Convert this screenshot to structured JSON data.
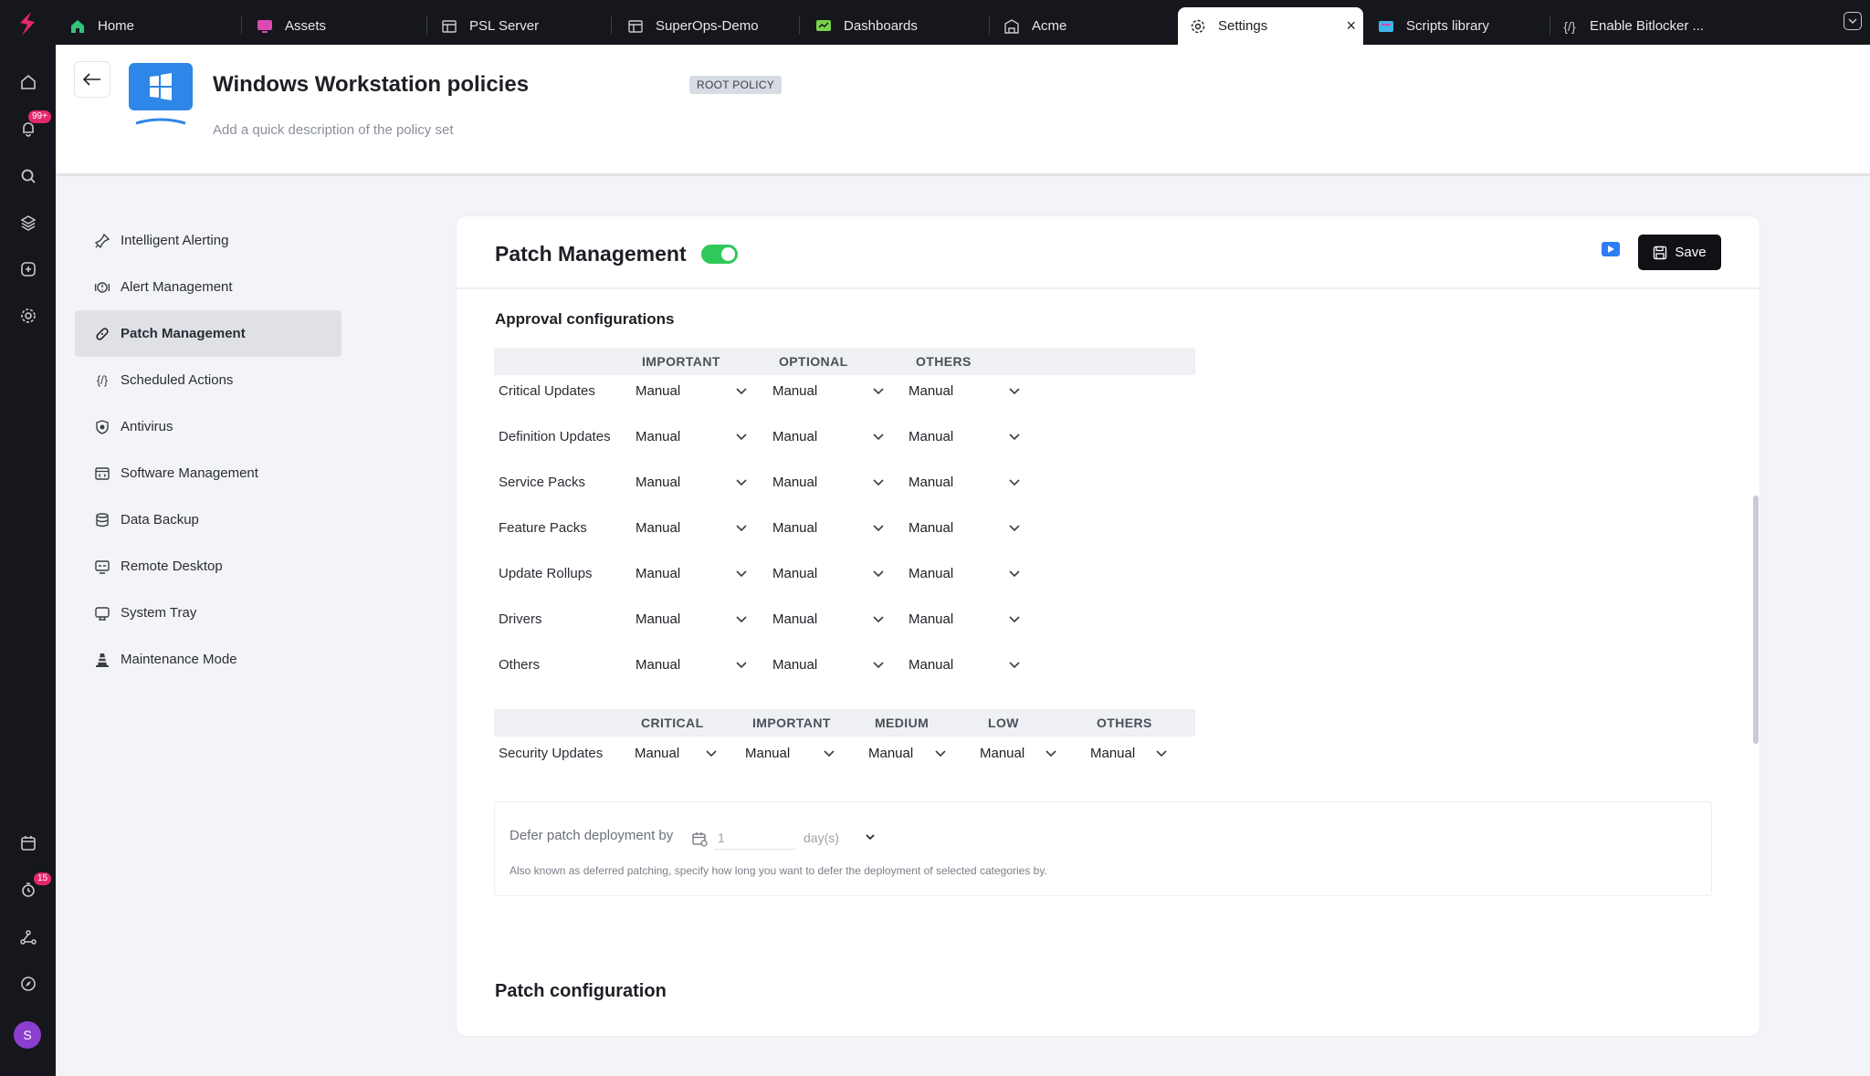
{
  "tabs": [
    {
      "label": "Home",
      "icon": "home-icon"
    },
    {
      "label": "Assets",
      "icon": "monitor-icon"
    },
    {
      "label": "PSL Server",
      "icon": "table-icon"
    },
    {
      "label": "SuperOps-Demo",
      "icon": "table-icon"
    },
    {
      "label": "Dashboards",
      "icon": "dashboard-icon"
    },
    {
      "label": "Acme",
      "icon": "building-icon"
    },
    {
      "label": "Settings",
      "icon": "gear-icon",
      "active": true
    },
    {
      "label": "Scripts library",
      "icon": "scripts-icon"
    },
    {
      "label": "Enable Bitlocker ...",
      "icon": "code-icon"
    }
  ],
  "rail": {
    "notifications_badge": "99+",
    "timer_badge": "15",
    "avatar_initial": "S"
  },
  "header": {
    "title": "Windows Workstation policies",
    "badge": "ROOT POLICY",
    "description_placeholder": "Add a quick description of the policy set"
  },
  "sidenav": [
    {
      "label": "Intelligent Alerting",
      "icon": "alert-pin-icon"
    },
    {
      "label": "Alert Management",
      "icon": "alert-management-icon"
    },
    {
      "label": "Patch Management",
      "icon": "patch-icon",
      "active": true
    },
    {
      "label": "Scheduled Actions",
      "icon": "code-icon"
    },
    {
      "label": "Antivirus",
      "icon": "shield-icon"
    },
    {
      "label": "Software Management",
      "icon": "software-icon"
    },
    {
      "label": "Data Backup",
      "icon": "database-icon"
    },
    {
      "label": "Remote Desktop",
      "icon": "remote-desktop-icon"
    },
    {
      "label": "System Tray",
      "icon": "system-tray-icon"
    },
    {
      "label": "Maintenance Mode",
      "icon": "traffic-cone-icon"
    }
  ],
  "card": {
    "title": "Patch Management",
    "toggle_on": true,
    "save_label": "Save",
    "approval_title": "Approval configurations",
    "approval_columns": [
      "IMPORTANT",
      "OPTIONAL",
      "OTHERS"
    ],
    "approval_rows": [
      {
        "label": "Critical Updates",
        "values": [
          "Manual",
          "Manual",
          "Manual"
        ]
      },
      {
        "label": "Definition Updates",
        "values": [
          "Manual",
          "Manual",
          "Manual"
        ]
      },
      {
        "label": "Service Packs",
        "values": [
          "Manual",
          "Manual",
          "Manual"
        ]
      },
      {
        "label": "Feature Packs",
        "values": [
          "Manual",
          "Manual",
          "Manual"
        ]
      },
      {
        "label": "Update Rollups",
        "values": [
          "Manual",
          "Manual",
          "Manual"
        ]
      },
      {
        "label": "Drivers",
        "values": [
          "Manual",
          "Manual",
          "Manual"
        ]
      },
      {
        "label": "Others",
        "values": [
          "Manual",
          "Manual",
          "Manual"
        ]
      }
    ],
    "security_columns": [
      "CRITICAL",
      "IMPORTANT",
      "MEDIUM",
      "LOW",
      "OTHERS"
    ],
    "security_row": {
      "label": "Security Updates",
      "values": [
        "Manual",
        "Manual",
        "Manual",
        "Manual",
        "Manual"
      ]
    },
    "defer_label": "Defer patch deployment by",
    "defer_value": "1",
    "defer_unit": "day(s)",
    "defer_help": "Also known as deferred patching, specify how long you want to defer the deployment of selected categories by.",
    "patch_config_title": "Patch configuration"
  }
}
